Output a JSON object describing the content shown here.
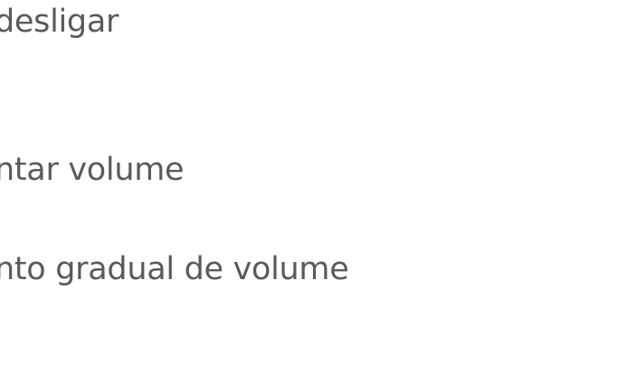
{
  "settings_list": {
    "items": [
      {
        "label": "desligar"
      },
      {
        "label": "ntar volume"
      },
      {
        "label": "nto gradual de volume"
      }
    ]
  }
}
